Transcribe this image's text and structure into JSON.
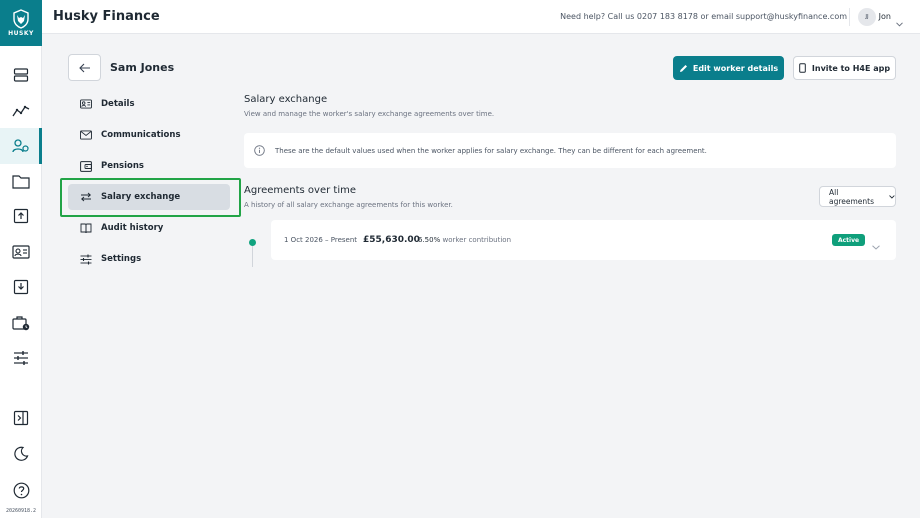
{
  "app": {
    "title": "Husky Finance",
    "logo_text": "HUSKY"
  },
  "header": {
    "help_text": "Need help? Call us 0207 183 8178 or email support@huskyfinance.com",
    "user_initials": "JJ",
    "user_name": "Jon"
  },
  "rail": {
    "icons": [
      "server-icon",
      "chart-line-icon",
      "people-icon",
      "folder-icon",
      "upload-icon",
      "id-card-icon",
      "download-icon",
      "briefcase-clock-icon",
      "sliders-icon",
      "panel-toggle-icon",
      "moon-icon",
      "help-icon"
    ],
    "version": "20260918.2"
  },
  "worker": {
    "name": "Sam Jones",
    "edit_label": "Edit worker details",
    "invite_label": "Invite to H4E app"
  },
  "nav": {
    "items": [
      {
        "label": "Details",
        "icon": "id-card-icon"
      },
      {
        "label": "Communications",
        "icon": "mail-icon"
      },
      {
        "label": "Pensions",
        "icon": "wallet-icon"
      },
      {
        "label": "Salary exchange",
        "icon": "swap-icon"
      },
      {
        "label": "Audit history",
        "icon": "book-icon"
      },
      {
        "label": "Settings",
        "icon": "sliders-icon"
      }
    ],
    "active": "Salary exchange"
  },
  "salary_exchange": {
    "title": "Salary exchange",
    "description": "View and manage the worker's salary exchange agreements over time.",
    "info": "These are the default values used when the worker applies for salary exchange. They can be different for each agreement."
  },
  "agreements": {
    "title": "Agreements over time",
    "description": "A history of all salary exchange agreements for this worker.",
    "filter": "All agreements",
    "items": [
      {
        "date": "1 Oct 2026 – Present",
        "amount": "£55,630.00",
        "percent": "6.50%",
        "percent_label": "worker contribution",
        "status": "Active"
      }
    ]
  },
  "colors": {
    "brand": "#0a7e8c",
    "active_badge": "#0f9f7b",
    "highlight": "#22a447"
  }
}
